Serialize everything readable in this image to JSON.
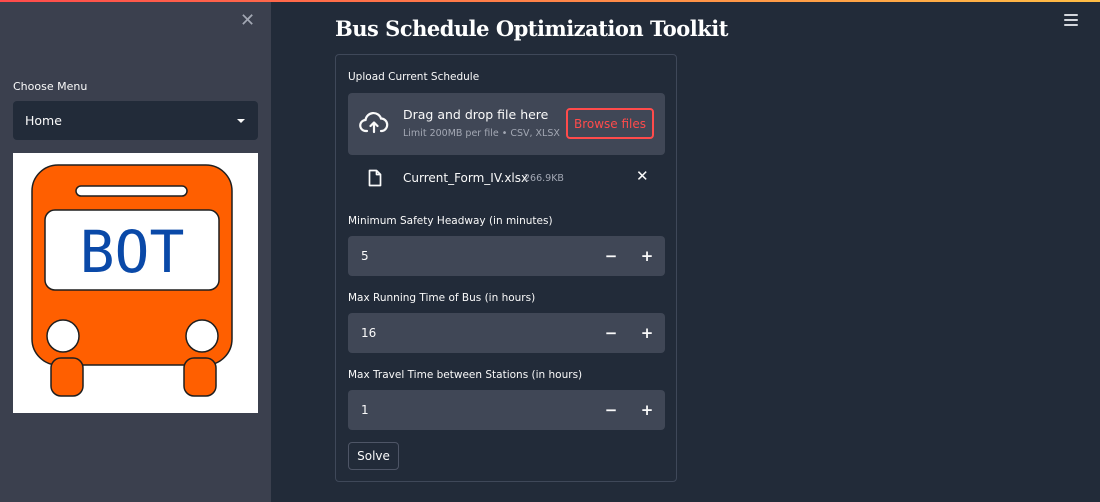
{
  "app": {
    "title": "Bus Schedule Optimization Toolkit"
  },
  "sidebar": {
    "menu_label": "Choose Menu",
    "menu_selected": "Home",
    "logo_text": "BOT",
    "colors": {
      "bus": "#ff5f00",
      "text": "#0a49a8"
    }
  },
  "icons": {
    "close": "close-icon",
    "menu": "hamburger-menu-icon",
    "upload": "cloud-upload-icon",
    "file": "file-icon",
    "remove": "x-icon",
    "dropdown": "chevron-down-icon"
  },
  "uploader": {
    "label": "Upload Current Schedule",
    "drop_text": "Drag and drop file here",
    "limit_text": "Limit 200MB per file • CSV, XLSX",
    "browse_label": "Browse files",
    "file_name": "Current_Form_IV.xlsx",
    "file_size": "266.9KB"
  },
  "fields": [
    {
      "label": "Minimum Safety Headway (in minutes)",
      "value": "5",
      "minus": "−",
      "plus": "+"
    },
    {
      "label": "Max Running Time of Bus (in hours)",
      "value": "16",
      "minus": "−",
      "plus": "+"
    },
    {
      "label": "Max Travel Time between Stations (in hours)",
      "value": "1",
      "minus": "−",
      "plus": "+"
    }
  ],
  "solve_label": "Solve",
  "colors": {
    "accent": "#ff4b4b",
    "background": "#222b39",
    "sidebar": "#3b404e",
    "input": "#404756"
  }
}
